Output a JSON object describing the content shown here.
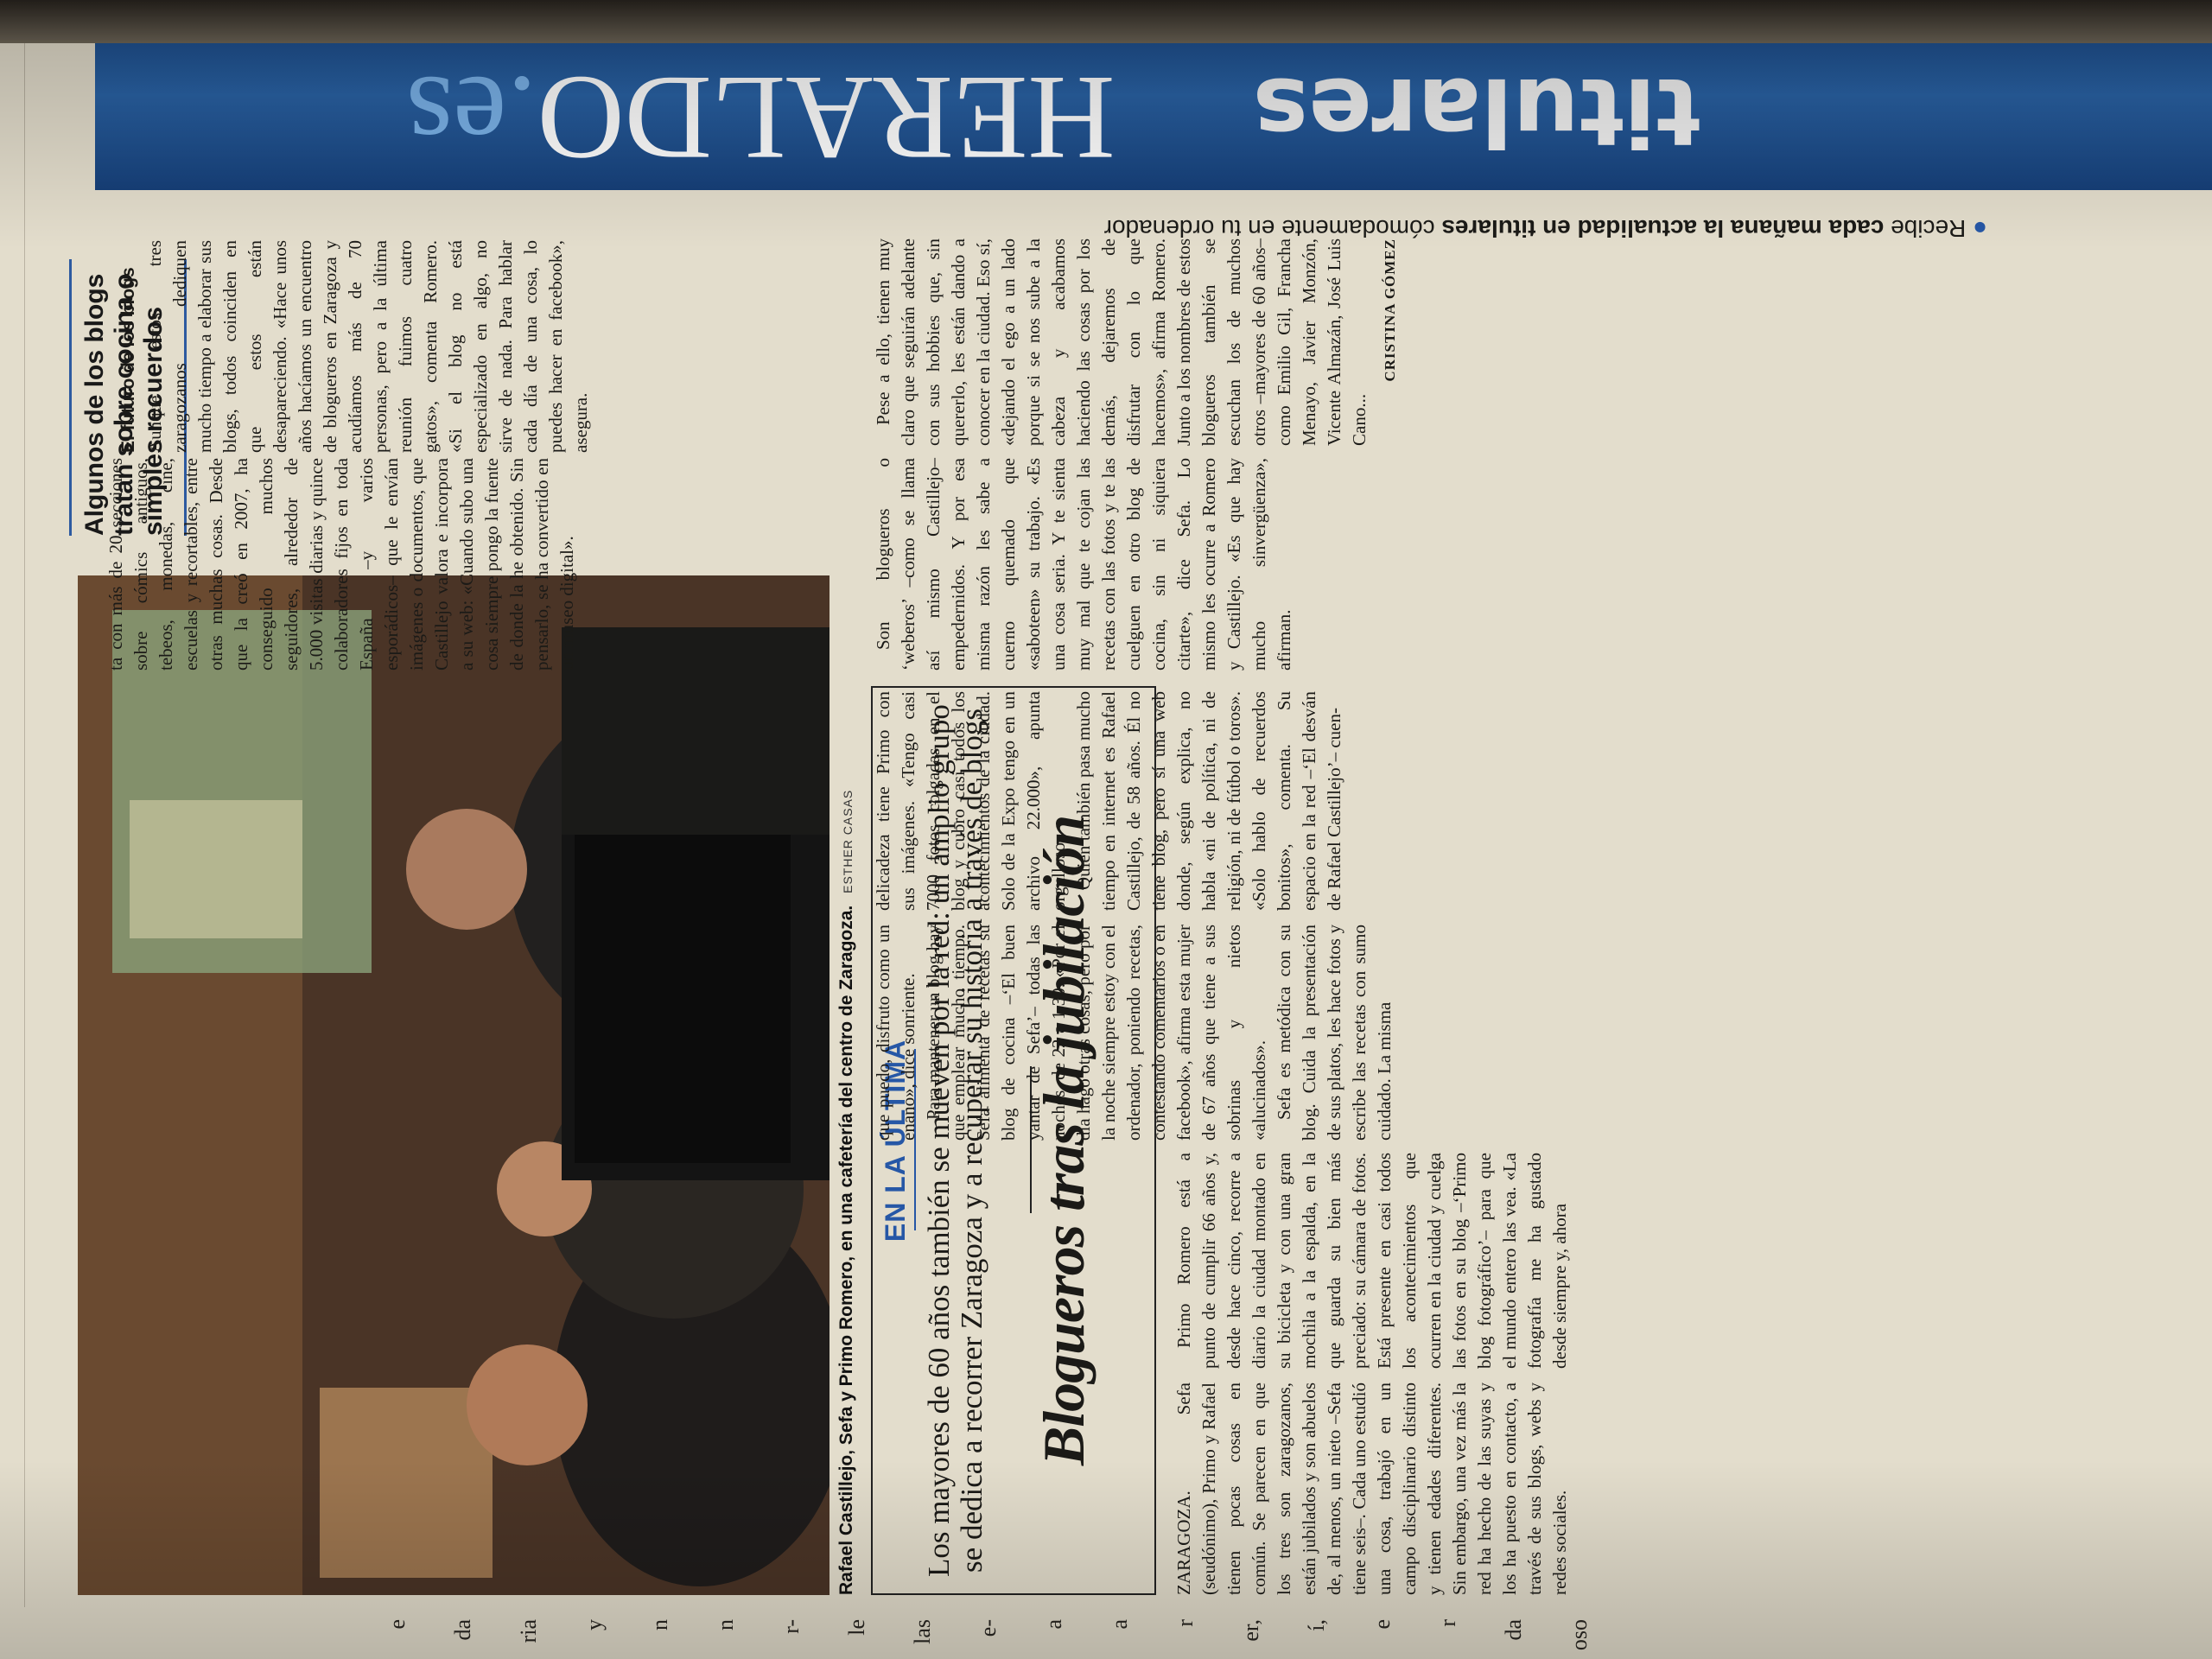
{
  "prev_column": {
    "fragments": [
      "e",
      "da",
      "ria",
      "y",
      "n",
      "n",
      "r-",
      "le",
      "las",
      "e-",
      "a",
      "a",
      "r",
      "er,",
      "í,",
      "e",
      "r",
      "da",
      "oso"
    ]
  },
  "photo": {
    "caption": "Rafael Castillejo, Sefa y Primo Romero, en una cafetería del centro de Zaragoza.",
    "credit": "ESTHER CASAS"
  },
  "sidebar": {
    "title": "Algunos de los blogs tratan sobre cocina o simples recuerdos"
  },
  "article": {
    "kicker": "EN LA ÚLTIMA",
    "subhead": "Los mayores de 60 años también se mueven por la red: un amplio grupo se dedica a recorrer Zaragoza y a recuperar su historia a través de blogs",
    "headline": "Blogueros tras la jubilación",
    "col1": "ZARAGOZA. Sefa (seudónimo), Primo y Rafael tienen pocas cosas en común. Se parecen en que los tres son zaragozanos, están jubilados y son abuelos de, al menos, un nieto –Sefa tiene seis–. Cada uno estudió una cosa, trabajó en un campo disciplinario distinto y tienen edades diferentes. Sin embargo, una vez más la red ha hecho de las suyas y los ha puesto en contacto, a través de sus blogs, webs y redes sociales.",
    "col2": "Primo Romero está a punto de cumplir 66 años y, desde hace cinco, recorre a diario la ciudad montado en su bicicleta y con una gran mochila a la espalda, en la que guarda su bien más preciado: su cámara de fotos. Está presente en casi todos los acontecimientos que ocurren en la ciudad y cuelga las fotos en su blog –‘Primo blog fotográfico’– para que el mundo entero las vea. «La fotografía me ha gustado desde siempre y, ahora",
    "col3_p1": "que puedo, disfruto como un enano», dice sonriente.",
    "col3_p2": "Para mantener un blog hay que emplear mucho tiempo. Sefa alimenta de recetas su blog de cocina –‘El buen yantar de Sefa’– todas las noches, de 22 a 1.30. «Por el día hago otras cosas, pero por la noche siempre estoy con el ordenador, poniendo recetas, contestando comentarios o en facebook», afirma esta mujer de 67 años que tiene a sus sobrinas y nietos «alucinados».",
    "col3_p3": "Sefa es metódica con su blog. Cuida la presentación de sus platos, les hace fotos y escribe las recetas con sumo cuidado. La misma",
    "col4_p1": "delicadeza tiene Primo con sus imágenes. «Tengo casi 7000 fotos colgadas en el blog y cubro casi todos los acontecimientos de la ciudad. Solo de la Expo tengo en un archivo 22.000», apunta orgulloso.",
    "col4_p2": "Quien también pasa mucho tiempo en internet es Rafael Castillejo, de 58 años. Él no tiene blog, pero sí una web donde, según explica, no habla «ni de política, ni de religión, ni de fútbol o toros». «Solo hablo de recuerdos bonitos», comenta. Su espacio en la red –‘El desván de Rafael Castillejo’– cuen-",
    "col5_p1": "ta con más de 20 secciones sobre cómics antiguos, tebeos, monedas, cine, escuelas y recortables, entre otras muchas cosas. Desde que la creó en 2007, ha conseguido muchos seguidores, alrededor de 5.000 visitas diarias y quince colaboradores fijos en toda España –y varios esporádicos– que le envían imágenes o documentos, que Castillejo valora e incorpora a su web: «Cuando subo una cosa siempre pongo la fuente de donde la he obtenido. Sin pensarlo, se ha convertido en un museo digital».",
    "col5_h": "El futuro de los blogs",
    "col5_p2": "Aunque estos tres zaragozanos dediquen mucho tiempo a elaborar sus blogs, todos coinciden en que estos están desapareciendo. «Hace unos años hacíamos un encuentro de blogueros en Zaragoza y acudíamos más de 70 personas, pero a la última reunión fuimos cuatro gatos», comenta Romero. «Si el blog no está especializado en algo, no sirve de nada. Para hablar cada día de una cosa, lo puedes hacer en facebook», asegura.",
    "col8_p1": "Son blogueros o ‘weberos’ –como se llama así mismo Castillejo– empedernidos. Y por esa misma razón les sabe a cuerno quemado que «saboteen» su trabajo. «Es una cosa seria. Y te sienta muy mal que te cojan las recetas con las fotos y te las cuelguen en otro blog de cocina, sin ni siquiera citarte», dice Sefa. Lo mismo les ocurre a Romero y Castillejo. «Es que hay mucho sinvergüenza», afirman.",
    "col8_p2": "Pese a ello, tienen muy claro que seguirán adelante con sus hobbies que, sin quererlo, les están dando a conocer en la ciudad. Eso sí, «dejando el ego a un lado porque si se nos sube a la cabeza y acabamos haciendo las cosas por los demás, dejaremos de disfrutar con lo que hacemos», afirma Romero. Junto a los nombres de estos blogueros también se escuchan los de muchos otros –mayores de 60 años– como Emilio Gil, Francha Menayo, Javier Monzón, Vicente Almazán, José Luis Cano...",
    "byline": "CRISTINA GÓMEZ"
  },
  "banner": {
    "word1": "titulares",
    "word2": "HERALDO",
    "word2_suffix": ".es",
    "tagline_prefix": "Recibe ",
    "tagline_bold": "cada mañana la actualidad en titulares",
    "tagline_rest": " cómodamente en tu ordenador"
  },
  "colors": {
    "accent_blue": "#2657a6",
    "banner_blue": "#1b4a88",
    "paper": "#e3ddcc"
  }
}
